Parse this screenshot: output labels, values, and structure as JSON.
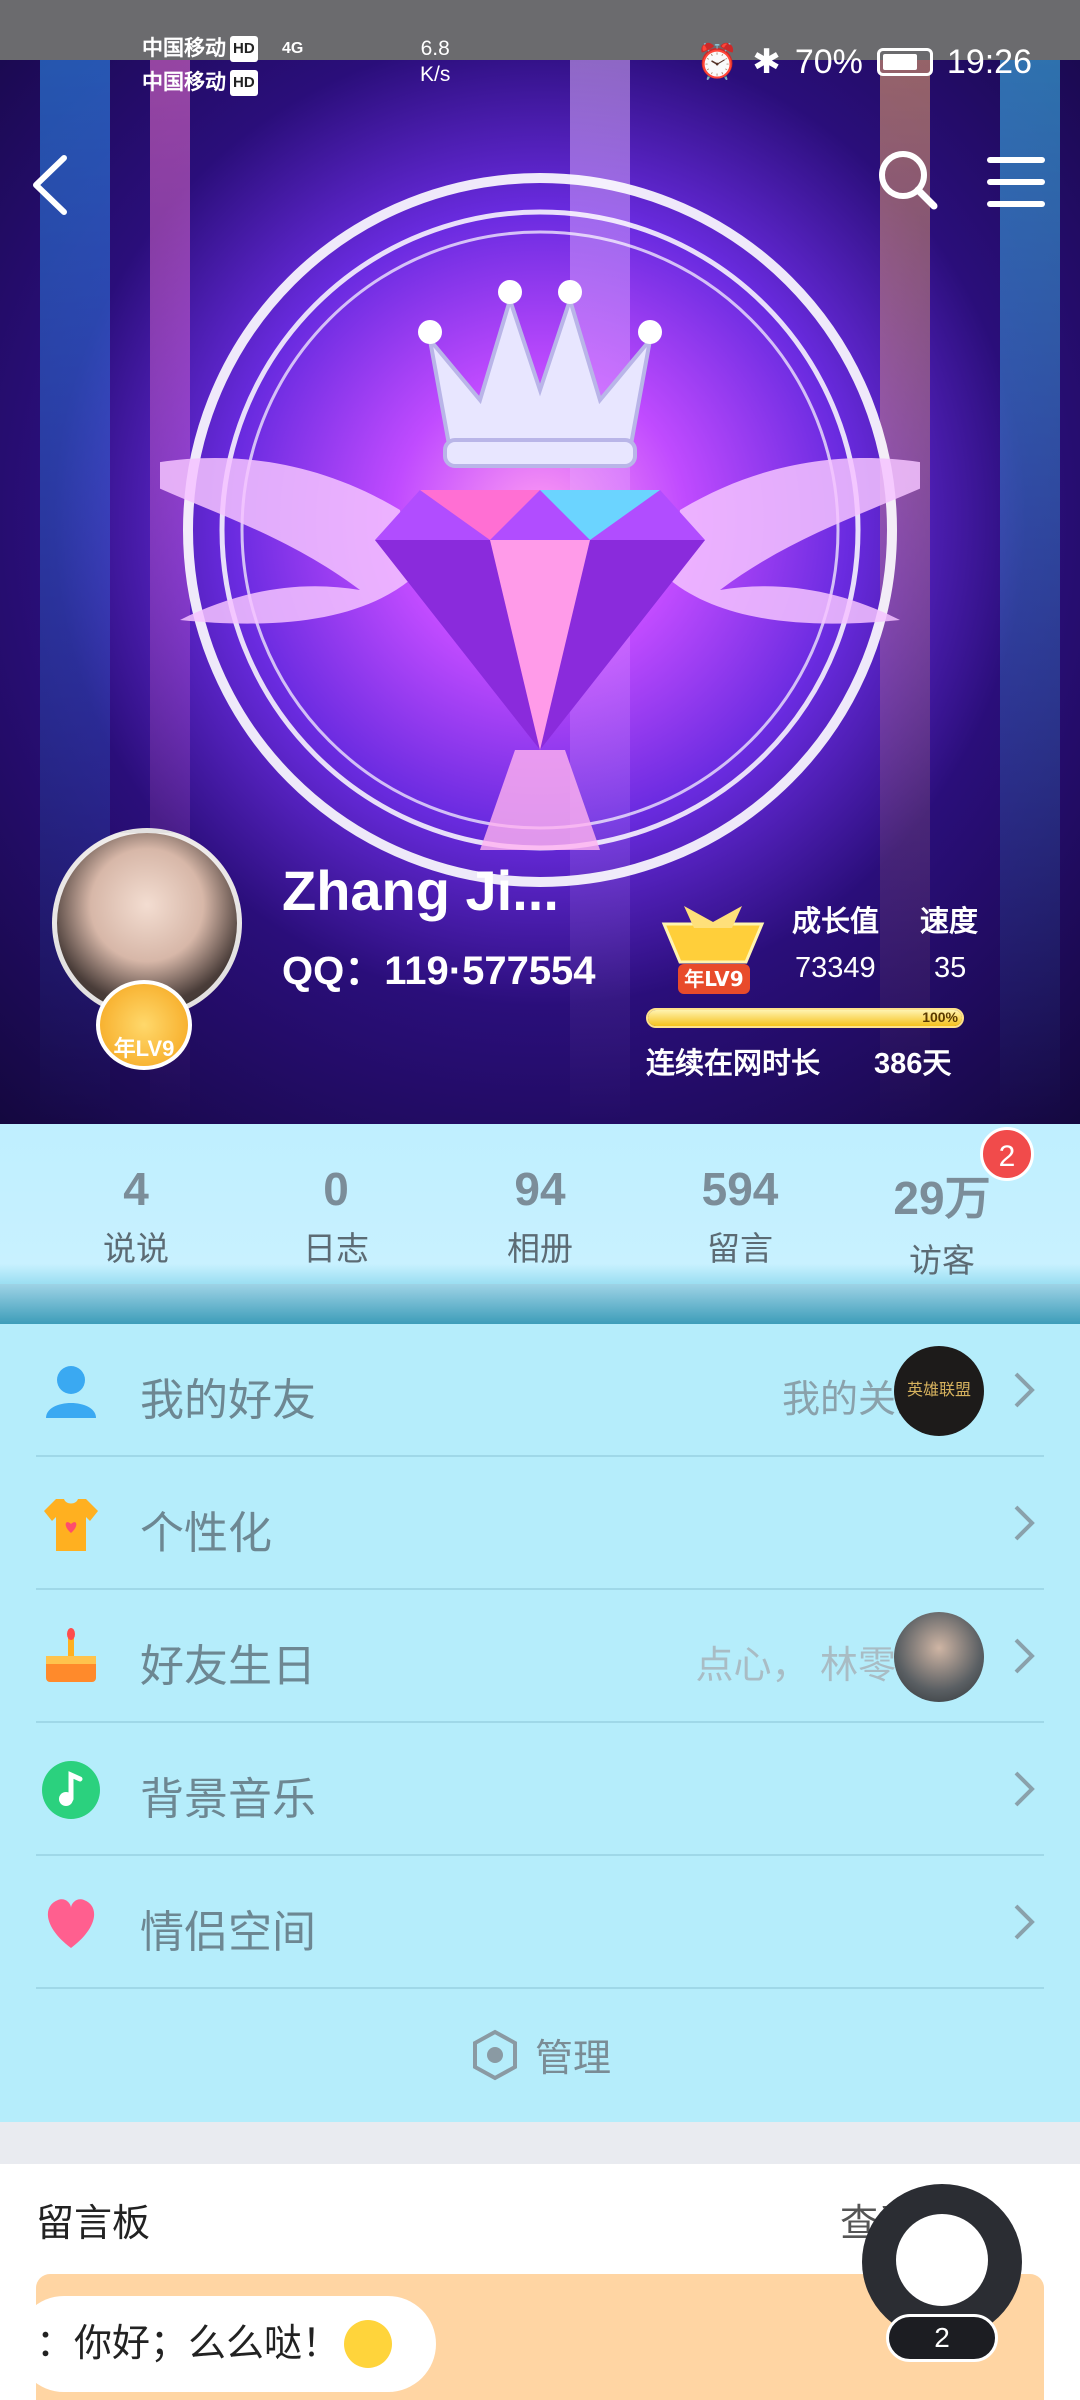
{
  "status_bar": {
    "carrier_1": "中国移动",
    "carrier_2": "中国移动",
    "hd": "HD",
    "network": "4G",
    "speed_value": "6.8",
    "speed_unit": "K/s",
    "battery": "70%",
    "time": "19:26"
  },
  "profile": {
    "name": "Zhang Ji...",
    "qq": "QQ：119·577554",
    "avatar_badge": "年LV9",
    "year_badge": "年LV9",
    "growth_label": "成长值",
    "growth_value": "73349",
    "speed_label": "速度",
    "speed_value": "35",
    "progress_percent": 100,
    "progress_text": "100%",
    "online_label": "连续在网时长",
    "online_value": "386天"
  },
  "stats": [
    {
      "num": "4",
      "label": "说说"
    },
    {
      "num": "0",
      "label": "日志"
    },
    {
      "num": "94",
      "label": "相册"
    },
    {
      "num": "594",
      "label": "留言"
    },
    {
      "num": "29万",
      "label": "访客"
    }
  ],
  "visitor_notification": "2",
  "menu": {
    "friends": {
      "label": "我的好友",
      "extra": "我的关注",
      "thumb_text": "英雄联盟"
    },
    "personalize": {
      "label": "个性化"
    },
    "birthday": {
      "label": "好友生日",
      "extra": "点心， 林零叔"
    },
    "music": {
      "label": "背景音乐"
    },
    "couple": {
      "label": "情侣空间"
    },
    "manage": "管理"
  },
  "guestbook": {
    "title": "留言板",
    "view_all": "查看全部",
    "message": "：你好；么么哒！"
  },
  "mascot_badge": "2",
  "colors": {
    "menu_bg": "#b5edfb",
    "notification": "#f14b4b",
    "progress": "#f6c21d"
  }
}
